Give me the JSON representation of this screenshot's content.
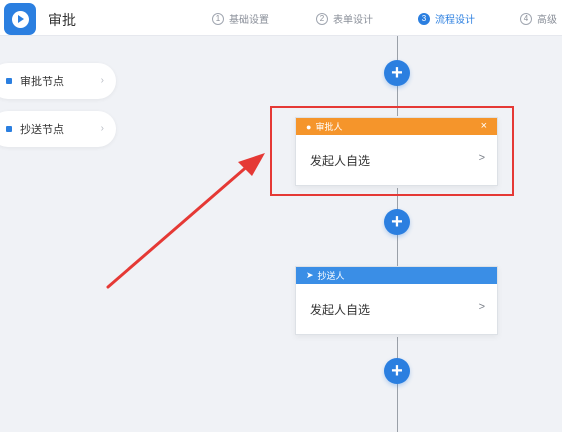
{
  "header": {
    "app_title": "审批",
    "steps": [
      {
        "num": "1",
        "label": "基础设置"
      },
      {
        "num": "2",
        "label": "表单设计"
      },
      {
        "num": "3",
        "label": "流程设计"
      },
      {
        "num": "4",
        "label": "高级"
      }
    ]
  },
  "sidebar": {
    "items": [
      {
        "label": "审批节点"
      },
      {
        "label": "抄送节点"
      }
    ]
  },
  "flow": {
    "approver_node": {
      "title": "审批人",
      "close": "×",
      "content": "发起人自选"
    },
    "cc_node": {
      "title": "抄送人",
      "content": "发起人自选"
    },
    "add_label": "+"
  },
  "colors": {
    "primary": "#2b7fe0",
    "approver_header": "#f5952b",
    "cc_header": "#3a8ee6",
    "annotation": "#e53935"
  }
}
